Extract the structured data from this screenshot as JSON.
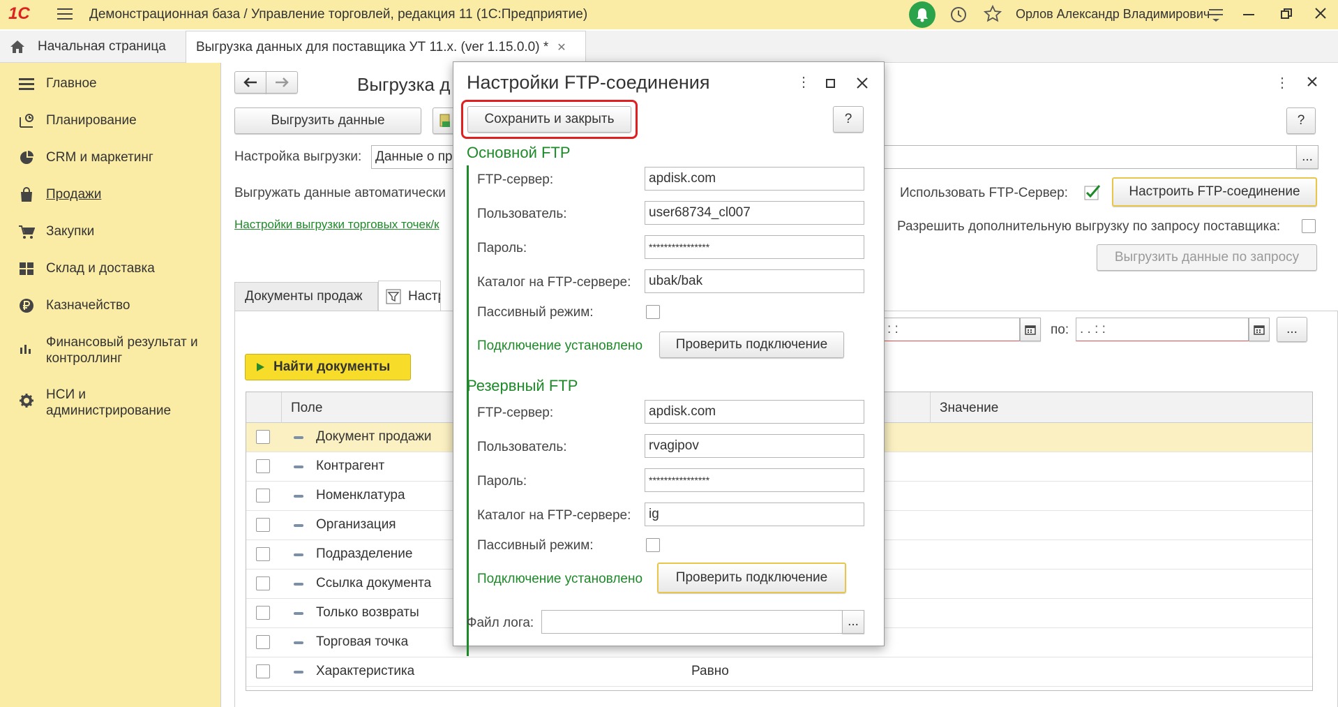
{
  "app": {
    "title": "Демонстрационная база / Управление торговлей, редакция 11  (1С:Предприятие)",
    "user": "Орлов Александр Владимирович",
    "logo": "1С"
  },
  "tabs": {
    "home": "Начальная страница",
    "active": "Выгрузка данных для поставщика УТ 11.х. (ver 1.15.0.0) *"
  },
  "sidebar": {
    "items": [
      {
        "label": "Главное",
        "icon": "menu-icon"
      },
      {
        "label": "Планирование",
        "icon": "planning-icon"
      },
      {
        "label": "CRM и маркетинг",
        "icon": "crm-icon"
      },
      {
        "label": "Продажи",
        "icon": "bag-icon"
      },
      {
        "label": "Закупки",
        "icon": "cart-icon"
      },
      {
        "label": "Склад и доставка",
        "icon": "warehouse-icon"
      },
      {
        "label": "Казначейство",
        "icon": "ruble-icon"
      },
      {
        "label": "Финансовый результат и контроллинг",
        "icon": "chart-icon"
      },
      {
        "label": "НСИ и администрирование",
        "icon": "gear-icon"
      }
    ]
  },
  "form": {
    "title": "Выгрузка д",
    "export_button": "Выгрузить данные",
    "settings_label": "Настройка выгрузки:",
    "settings_value": "Данные о пр",
    "auto_label": "Выгружать данные автоматически",
    "link": "Настройки выгрузки торговых точек/к",
    "use_ftp_label": "Использовать FTP-Сервер:",
    "configure_ftp_button": "Настроить FTP-соединение",
    "allow_extra_label": "Разрешить дополнительную выгрузку по запросу поставщика:",
    "export_request_button": "Выгрузить данные по запросу",
    "help": "?",
    "ellipsis": "...",
    "tab_sales_docs": "Документы продаж",
    "tab_settings": "Настро",
    "date_to_label": "по:",
    "date_mask_from": " :  :",
    "date_mask_to": " .   .        :  :",
    "find_button": "Найти документы",
    "col_field": "Поле",
    "col_value": "Значение",
    "rows": [
      {
        "name": "Документ продажи",
        "value": ""
      },
      {
        "name": "Контрагент",
        "value": ""
      },
      {
        "name": "Номенклатура",
        "value": ""
      },
      {
        "name": "Организация",
        "value": ""
      },
      {
        "name": "Подразделение",
        "value": ""
      },
      {
        "name": "Ссылка документа",
        "value": ""
      },
      {
        "name": "Только возвраты",
        "value": ""
      },
      {
        "name": "Торговая точка",
        "value": ""
      },
      {
        "name": "Характеристика",
        "value": "Равно"
      }
    ]
  },
  "dialog": {
    "title": "Настройки FTP-соединения",
    "save_close": "Сохранить и закрыть",
    "help": "?",
    "primary": {
      "header": "Основной FTP",
      "server_label": "FTP-сервер:",
      "server": "apdisk.com",
      "user_label": "Пользователь:",
      "user": "user68734_cl007",
      "password_label": "Пароль:",
      "password": "****************",
      "dir_label": "Каталог на FTP-сервере:",
      "dir": "ubak/bak",
      "passive_label": "Пассивный режим:",
      "status": "Подключение установлено",
      "check_button": "Проверить подключение"
    },
    "backup": {
      "header": "Резервный FTP",
      "server_label": "FTP-сервер:",
      "server": "apdisk.com",
      "user_label": "Пользователь:",
      "user": "rvagipov",
      "password_label": "Пароль:",
      "password": "****************",
      "dir_label": "Каталог на FTP-сервере:",
      "dir": "ig",
      "passive_label": "Пассивный режим:",
      "status": "Подключение установлено",
      "check_button": "Проверить подключение"
    },
    "log_label": "Файл лога:",
    "log_value": "",
    "ellipsis": "..."
  },
  "colors": {
    "sidebar_bg": "#fbeca5",
    "green": "#1d8a28",
    "highlight_red": "#e02020",
    "selected_row": "#fbf0c2",
    "find_button": "#f7dc2a"
  }
}
